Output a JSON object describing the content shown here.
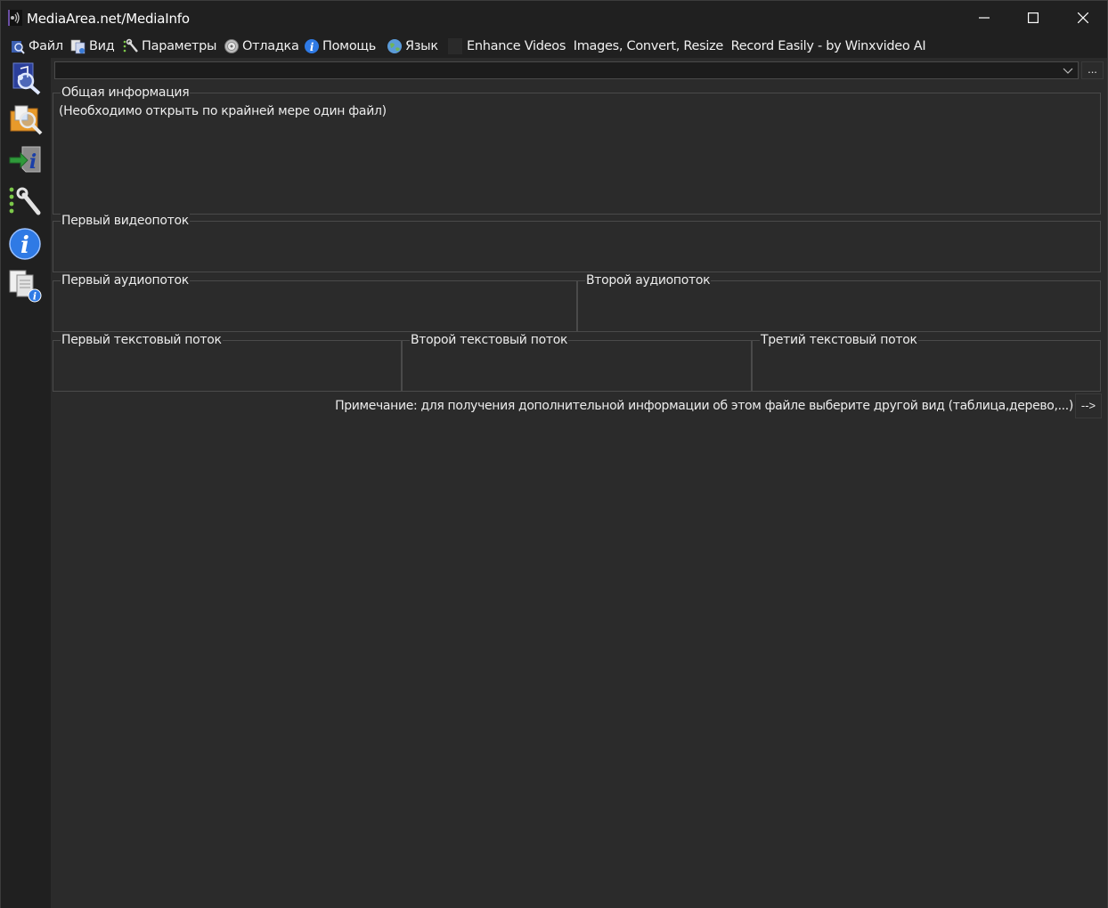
{
  "window": {
    "title": "MediaArea.net/MediaInfo"
  },
  "menu": {
    "items": [
      {
        "label": "Файл",
        "icon": "file-open-icon"
      },
      {
        "label": "Вид",
        "icon": "view-icon"
      },
      {
        "label": "Параметры",
        "icon": "settings-wrench-icon"
      },
      {
        "label": "Отладка",
        "icon": "debug-icon"
      },
      {
        "label": "Помощь",
        "icon": "help-info-icon"
      },
      {
        "label": "Язык",
        "icon": "globe-icon"
      }
    ],
    "ad_text": "Enhance Videos  Images, Convert, Resize  Record Easily - by Winxvideo AI"
  },
  "toolbar": {
    "tools": [
      "open-file-icon",
      "open-folder-icon",
      "export-icon",
      "preferences-icon",
      "about-icon",
      "copy-info-icon"
    ]
  },
  "file_combo": {
    "value": "",
    "browse_label": "..."
  },
  "groups": {
    "general": {
      "label": "Общая информация",
      "body": "(Необходимо открыть по крайней мере один файл)"
    },
    "video1": {
      "label": "Первый видеопоток"
    },
    "audio1": {
      "label": "Первый аудиопоток"
    },
    "audio2": {
      "label": "Второй аудиопоток"
    },
    "text1": {
      "label": "Первый текстовый поток"
    },
    "text2": {
      "label": "Второй текстовый поток"
    },
    "text3": {
      "label": "Третий текстовый поток"
    }
  },
  "note": {
    "text": "Примечание: для получения дополнительной информации об этом файле выберите другой вид (таблица,дерево,...)",
    "button": "-->"
  },
  "colors": {
    "background": "#2b2b2b",
    "titlebar": "#202020",
    "border": "#4a4a4a",
    "text": "#ececec"
  }
}
